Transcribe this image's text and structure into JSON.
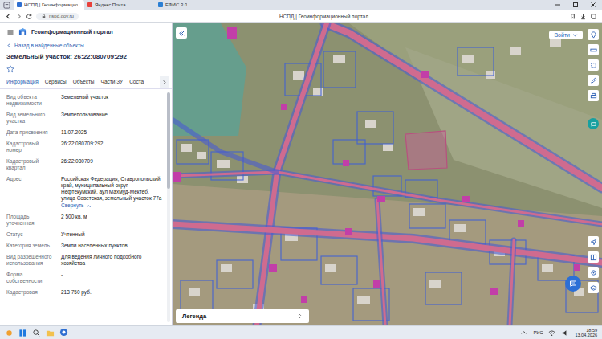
{
  "browser": {
    "tabs": [
      {
        "label": "НСПД | Геоинформацио",
        "selected": true
      },
      {
        "label": "Яндекс Почта",
        "selected": false
      },
      {
        "label": "ЕФИС 3.0",
        "selected": false
      }
    ],
    "address": "nspd.gov.ru",
    "title": "НСПД | Геоинформационный портал"
  },
  "panel": {
    "portal": "Геоинформационный портал",
    "back": "Назад в найденные объекты",
    "object_title": "Земельный участок: 26:22:080709:292",
    "favorite": false,
    "tabs": [
      {
        "label": "Информация",
        "selected": true
      },
      {
        "label": "Сервисы",
        "selected": false
      },
      {
        "label": "Объекты",
        "selected": false
      },
      {
        "label": "Части ЗУ",
        "selected": false
      },
      {
        "label": "Соста",
        "selected": false
      }
    ],
    "fields": [
      {
        "kind": "text",
        "label": "Вид объекта недвижимости",
        "value": "Земельный участок"
      },
      {
        "kind": "text",
        "label": "Вид земельного участка",
        "value": "Землепользование"
      },
      {
        "kind": "text",
        "label": "Дата присвоения",
        "value": "11.07.2025"
      },
      {
        "kind": "text",
        "label": "Кадастровый номер",
        "value": "26:22:080709:292"
      },
      {
        "kind": "text",
        "label": "Кадастровый квартал",
        "value": "26:22:080709"
      },
      {
        "kind": "collapsible",
        "label": "Адрес",
        "value": "Российская Федерация, Ставропольский край, муниципальный округ Нефтекумский, аул Махмуд-Мектеб, улица Советская, земельный участок 77а",
        "link": "Свернуть"
      },
      {
        "kind": "text",
        "label": "Площадь уточненная",
        "value": "2 500 кв. м"
      },
      {
        "kind": "text",
        "label": "Статус",
        "value": "Учтенный"
      },
      {
        "kind": "text",
        "label": "Категория земель",
        "value": "Земли населенных пунктов"
      },
      {
        "kind": "text",
        "label": "Вид разрешенного использования",
        "value": "Для ведения личного подсобного хозяйства"
      },
      {
        "kind": "text",
        "label": "Форма собственности",
        "value": "-"
      },
      {
        "kind": "text",
        "label": "Кадастровая",
        "value": "213 750 руб."
      }
    ]
  },
  "map": {
    "login": "Войти",
    "legend": "Легенда"
  },
  "taskbar": {
    "lang": "РУС",
    "time": "18:59",
    "date": "13.04.2026"
  }
}
